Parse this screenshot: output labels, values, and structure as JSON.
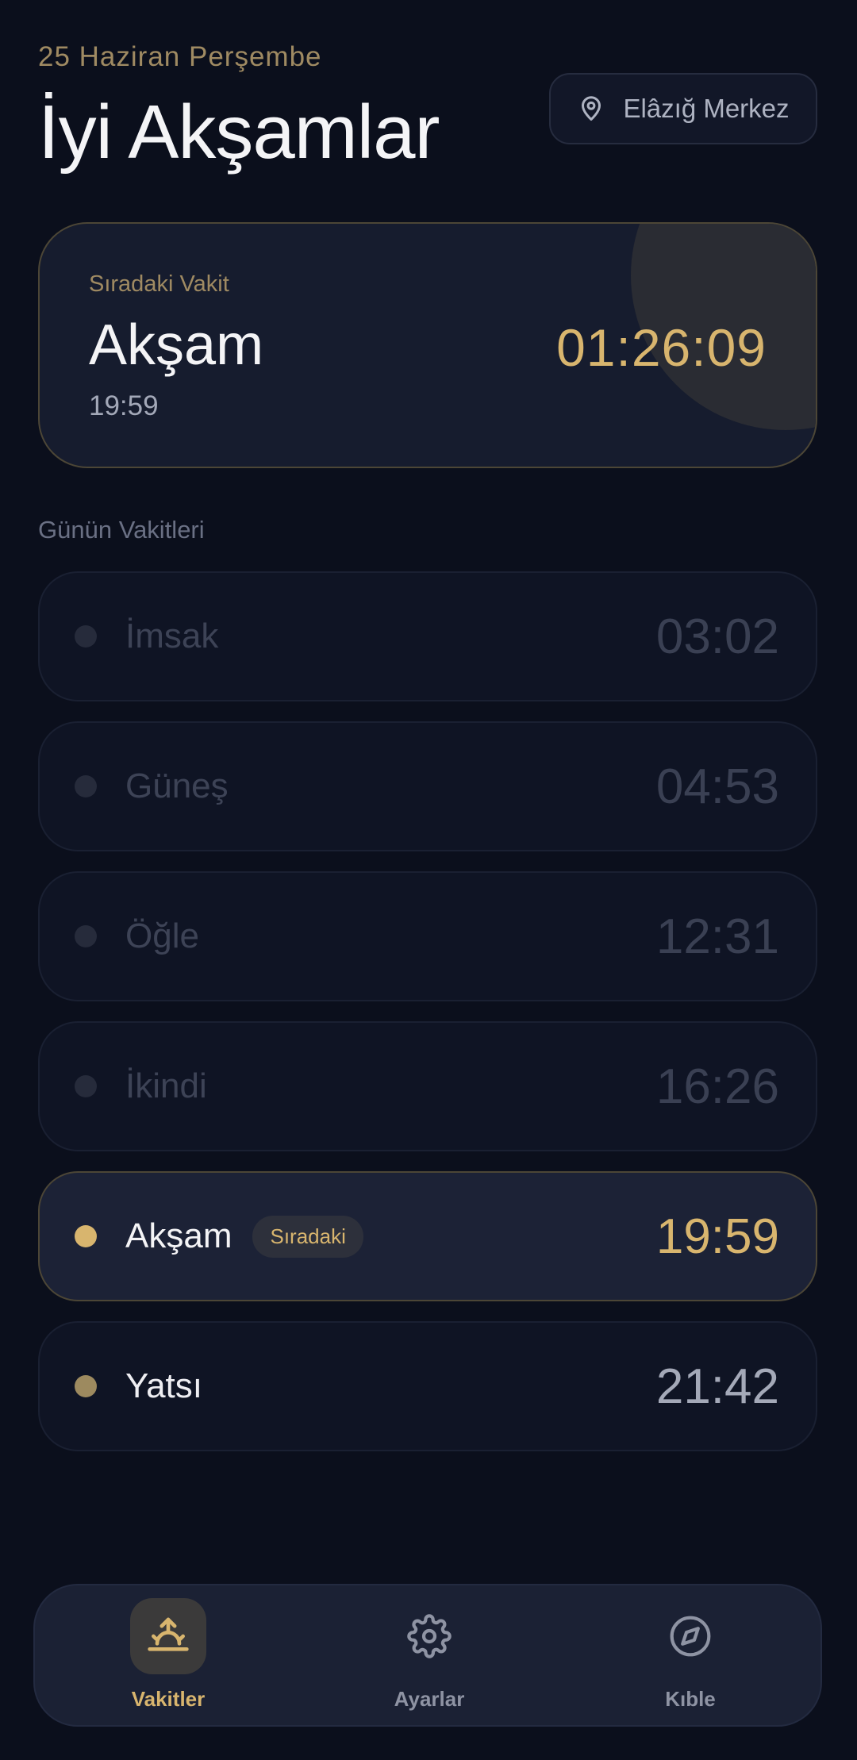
{
  "header": {
    "date": "25 Haziran Perşembe",
    "greeting": "İyi Akşamlar",
    "location": "Elâzığ Merkez"
  },
  "next_prayer": {
    "label": "Sıradaki Vakit",
    "name": "Akşam",
    "time": "19:59",
    "countdown": "01:26:09"
  },
  "section_title": "Günün Vakitleri",
  "prayers": [
    {
      "name": "İmsak",
      "time": "03:02",
      "state": "past"
    },
    {
      "name": "Güneş",
      "time": "04:53",
      "state": "past"
    },
    {
      "name": "Öğle",
      "time": "12:31",
      "state": "past"
    },
    {
      "name": "İkindi",
      "time": "16:26",
      "state": "past"
    },
    {
      "name": "Akşam",
      "time": "19:59",
      "state": "current",
      "badge": "Sıradaki"
    },
    {
      "name": "Yatsı",
      "time": "21:42",
      "state": "upcoming"
    }
  ],
  "nav": {
    "items": [
      {
        "label": "Vakitler",
        "icon": "sunrise-icon",
        "active": true
      },
      {
        "label": "Ayarlar",
        "icon": "gear-icon",
        "active": false
      },
      {
        "label": "Kıble",
        "icon": "compass-icon",
        "active": false
      }
    ]
  },
  "colors": {
    "background": "#0b0f1c",
    "accent": "#d8b56e",
    "card": "#161c2e",
    "muted": "#3d4356"
  }
}
